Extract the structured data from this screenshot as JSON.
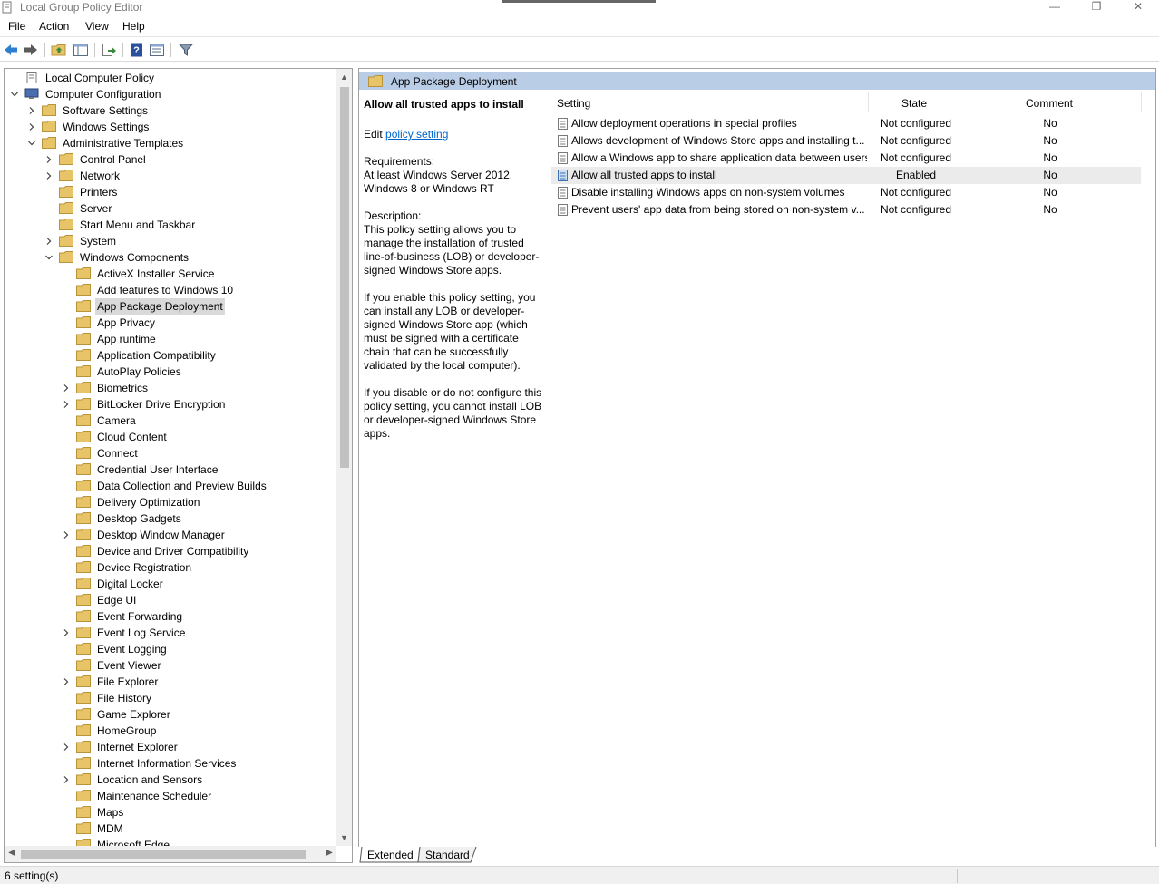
{
  "window": {
    "title": "Local Group Policy Editor",
    "controls": {
      "minimize": "—",
      "restore": "❐",
      "close": "✕"
    }
  },
  "menu": [
    "File",
    "Action",
    "View",
    "Help"
  ],
  "toolbar": {
    "buttons": [
      "back-arrow-icon",
      "forward-arrow-icon",
      "up-folder-icon",
      "show-hide-tree-icon",
      "export-list-icon",
      "help-icon",
      "properties-icon",
      "filter-icon"
    ]
  },
  "tree": {
    "items": [
      {
        "label": "Local Computer Policy",
        "level": 0,
        "expander": "none",
        "icon": "policy-doc-icon"
      },
      {
        "label": "Computer Configuration",
        "level": 0,
        "expander": "expanded",
        "icon": "computer-icon"
      },
      {
        "label": "Software Settings",
        "level": 1,
        "expander": "collapsed",
        "icon": "folder-icon"
      },
      {
        "label": "Windows Settings",
        "level": 1,
        "expander": "collapsed",
        "icon": "folder-icon"
      },
      {
        "label": "Administrative Templates",
        "level": 1,
        "expander": "expanded",
        "icon": "folder-icon"
      },
      {
        "label": "Control Panel",
        "level": 2,
        "expander": "collapsed",
        "icon": "folder-icon"
      },
      {
        "label": "Network",
        "level": 2,
        "expander": "collapsed",
        "icon": "folder-icon"
      },
      {
        "label": "Printers",
        "level": 2,
        "expander": "none",
        "icon": "folder-icon"
      },
      {
        "label": "Server",
        "level": 2,
        "expander": "none",
        "icon": "folder-icon"
      },
      {
        "label": "Start Menu and Taskbar",
        "level": 2,
        "expander": "none",
        "icon": "folder-icon"
      },
      {
        "label": "System",
        "level": 2,
        "expander": "collapsed",
        "icon": "folder-icon"
      },
      {
        "label": "Windows Components",
        "level": 2,
        "expander": "expanded",
        "icon": "folder-icon"
      },
      {
        "label": "ActiveX Installer Service",
        "level": 3,
        "expander": "none",
        "icon": "folder-icon"
      },
      {
        "label": "Add features to Windows 10",
        "level": 3,
        "expander": "none",
        "icon": "folder-icon"
      },
      {
        "label": "App Package Deployment",
        "level": 3,
        "expander": "none",
        "icon": "folder-icon",
        "selected": true
      },
      {
        "label": "App Privacy",
        "level": 3,
        "expander": "none",
        "icon": "folder-icon"
      },
      {
        "label": "App runtime",
        "level": 3,
        "expander": "none",
        "icon": "folder-icon"
      },
      {
        "label": "Application Compatibility",
        "level": 3,
        "expander": "none",
        "icon": "folder-icon"
      },
      {
        "label": "AutoPlay Policies",
        "level": 3,
        "expander": "none",
        "icon": "folder-icon"
      },
      {
        "label": "Biometrics",
        "level": 3,
        "expander": "collapsed",
        "icon": "folder-icon"
      },
      {
        "label": "BitLocker Drive Encryption",
        "level": 3,
        "expander": "collapsed",
        "icon": "folder-icon"
      },
      {
        "label": "Camera",
        "level": 3,
        "expander": "none",
        "icon": "folder-icon"
      },
      {
        "label": "Cloud Content",
        "level": 3,
        "expander": "none",
        "icon": "folder-icon"
      },
      {
        "label": "Connect",
        "level": 3,
        "expander": "none",
        "icon": "folder-icon"
      },
      {
        "label": "Credential User Interface",
        "level": 3,
        "expander": "none",
        "icon": "folder-icon"
      },
      {
        "label": "Data Collection and Preview Builds",
        "level": 3,
        "expander": "none",
        "icon": "folder-icon"
      },
      {
        "label": "Delivery Optimization",
        "level": 3,
        "expander": "none",
        "icon": "folder-icon"
      },
      {
        "label": "Desktop Gadgets",
        "level": 3,
        "expander": "none",
        "icon": "folder-icon"
      },
      {
        "label": "Desktop Window Manager",
        "level": 3,
        "expander": "collapsed",
        "icon": "folder-icon"
      },
      {
        "label": "Device and Driver Compatibility",
        "level": 3,
        "expander": "none",
        "icon": "folder-icon"
      },
      {
        "label": "Device Registration",
        "level": 3,
        "expander": "none",
        "icon": "folder-icon"
      },
      {
        "label": "Digital Locker",
        "level": 3,
        "expander": "none",
        "icon": "folder-icon"
      },
      {
        "label": "Edge UI",
        "level": 3,
        "expander": "none",
        "icon": "folder-icon"
      },
      {
        "label": "Event Forwarding",
        "level": 3,
        "expander": "none",
        "icon": "folder-icon"
      },
      {
        "label": "Event Log Service",
        "level": 3,
        "expander": "collapsed",
        "icon": "folder-icon"
      },
      {
        "label": "Event Logging",
        "level": 3,
        "expander": "none",
        "icon": "folder-icon"
      },
      {
        "label": "Event Viewer",
        "level": 3,
        "expander": "none",
        "icon": "folder-icon"
      },
      {
        "label": "File Explorer",
        "level": 3,
        "expander": "collapsed",
        "icon": "folder-icon"
      },
      {
        "label": "File History",
        "level": 3,
        "expander": "none",
        "icon": "folder-icon"
      },
      {
        "label": "Game Explorer",
        "level": 3,
        "expander": "none",
        "icon": "folder-icon"
      },
      {
        "label": "HomeGroup",
        "level": 3,
        "expander": "none",
        "icon": "folder-icon"
      },
      {
        "label": "Internet Explorer",
        "level": 3,
        "expander": "collapsed",
        "icon": "folder-icon"
      },
      {
        "label": "Internet Information Services",
        "level": 3,
        "expander": "none",
        "icon": "folder-icon"
      },
      {
        "label": "Location and Sensors",
        "level": 3,
        "expander": "collapsed",
        "icon": "folder-icon"
      },
      {
        "label": "Maintenance Scheduler",
        "level": 3,
        "expander": "none",
        "icon": "folder-icon"
      },
      {
        "label": "Maps",
        "level": 3,
        "expander": "none",
        "icon": "folder-icon"
      },
      {
        "label": "MDM",
        "level": 3,
        "expander": "none",
        "icon": "folder-icon"
      },
      {
        "label": "Microsoft Edge",
        "level": 3,
        "expander": "none",
        "icon": "folder-icon"
      }
    ]
  },
  "details": {
    "header_title": "App Package Deployment",
    "description": {
      "title": "Allow all trusted apps to install",
      "edit_prefix": "Edit",
      "edit_link": "policy setting",
      "requirements_label": "Requirements:",
      "requirements_text": "At least Windows Server 2012, Windows 8 or Windows RT",
      "description_label": "Description:",
      "description_p1": "This policy setting allows you to manage the installation of trusted line-of-business (LOB) or developer-signed Windows Store apps.",
      "description_p2": "If you enable this policy setting, you can install any LOB or developer-signed Windows Store app (which must be signed with a certificate chain that can be successfully validated by the local computer).",
      "description_p3": "If you disable or do not configure this policy setting, you cannot install LOB or developer-signed Windows Store apps."
    },
    "columns": {
      "setting": "Setting",
      "state": "State",
      "comment": "Comment"
    },
    "rows": [
      {
        "setting": "Allow deployment operations in special profiles",
        "state": "Not configured",
        "comment": "No"
      },
      {
        "setting": "Allows development of Windows Store apps and installing t...",
        "state": "Not configured",
        "comment": "No"
      },
      {
        "setting": "Allow a Windows app to share application data between users",
        "state": "Not configured",
        "comment": "No"
      },
      {
        "setting": "Allow all trusted apps to install",
        "state": "Enabled",
        "comment": "No",
        "selected": true
      },
      {
        "setting": "Disable installing Windows apps on non-system volumes",
        "state": "Not configured",
        "comment": "No"
      },
      {
        "setting": "Prevent users' app data from being stored on non-system v...",
        "state": "Not configured",
        "comment": "No"
      }
    ],
    "tabs": [
      "Extended",
      "Standard"
    ]
  },
  "status": {
    "text": "6 setting(s)"
  },
  "colors": {
    "header_band": "#b9cde6",
    "link": "#0066cc",
    "selection": "#d9d9d9",
    "folder": "#e8c468"
  }
}
